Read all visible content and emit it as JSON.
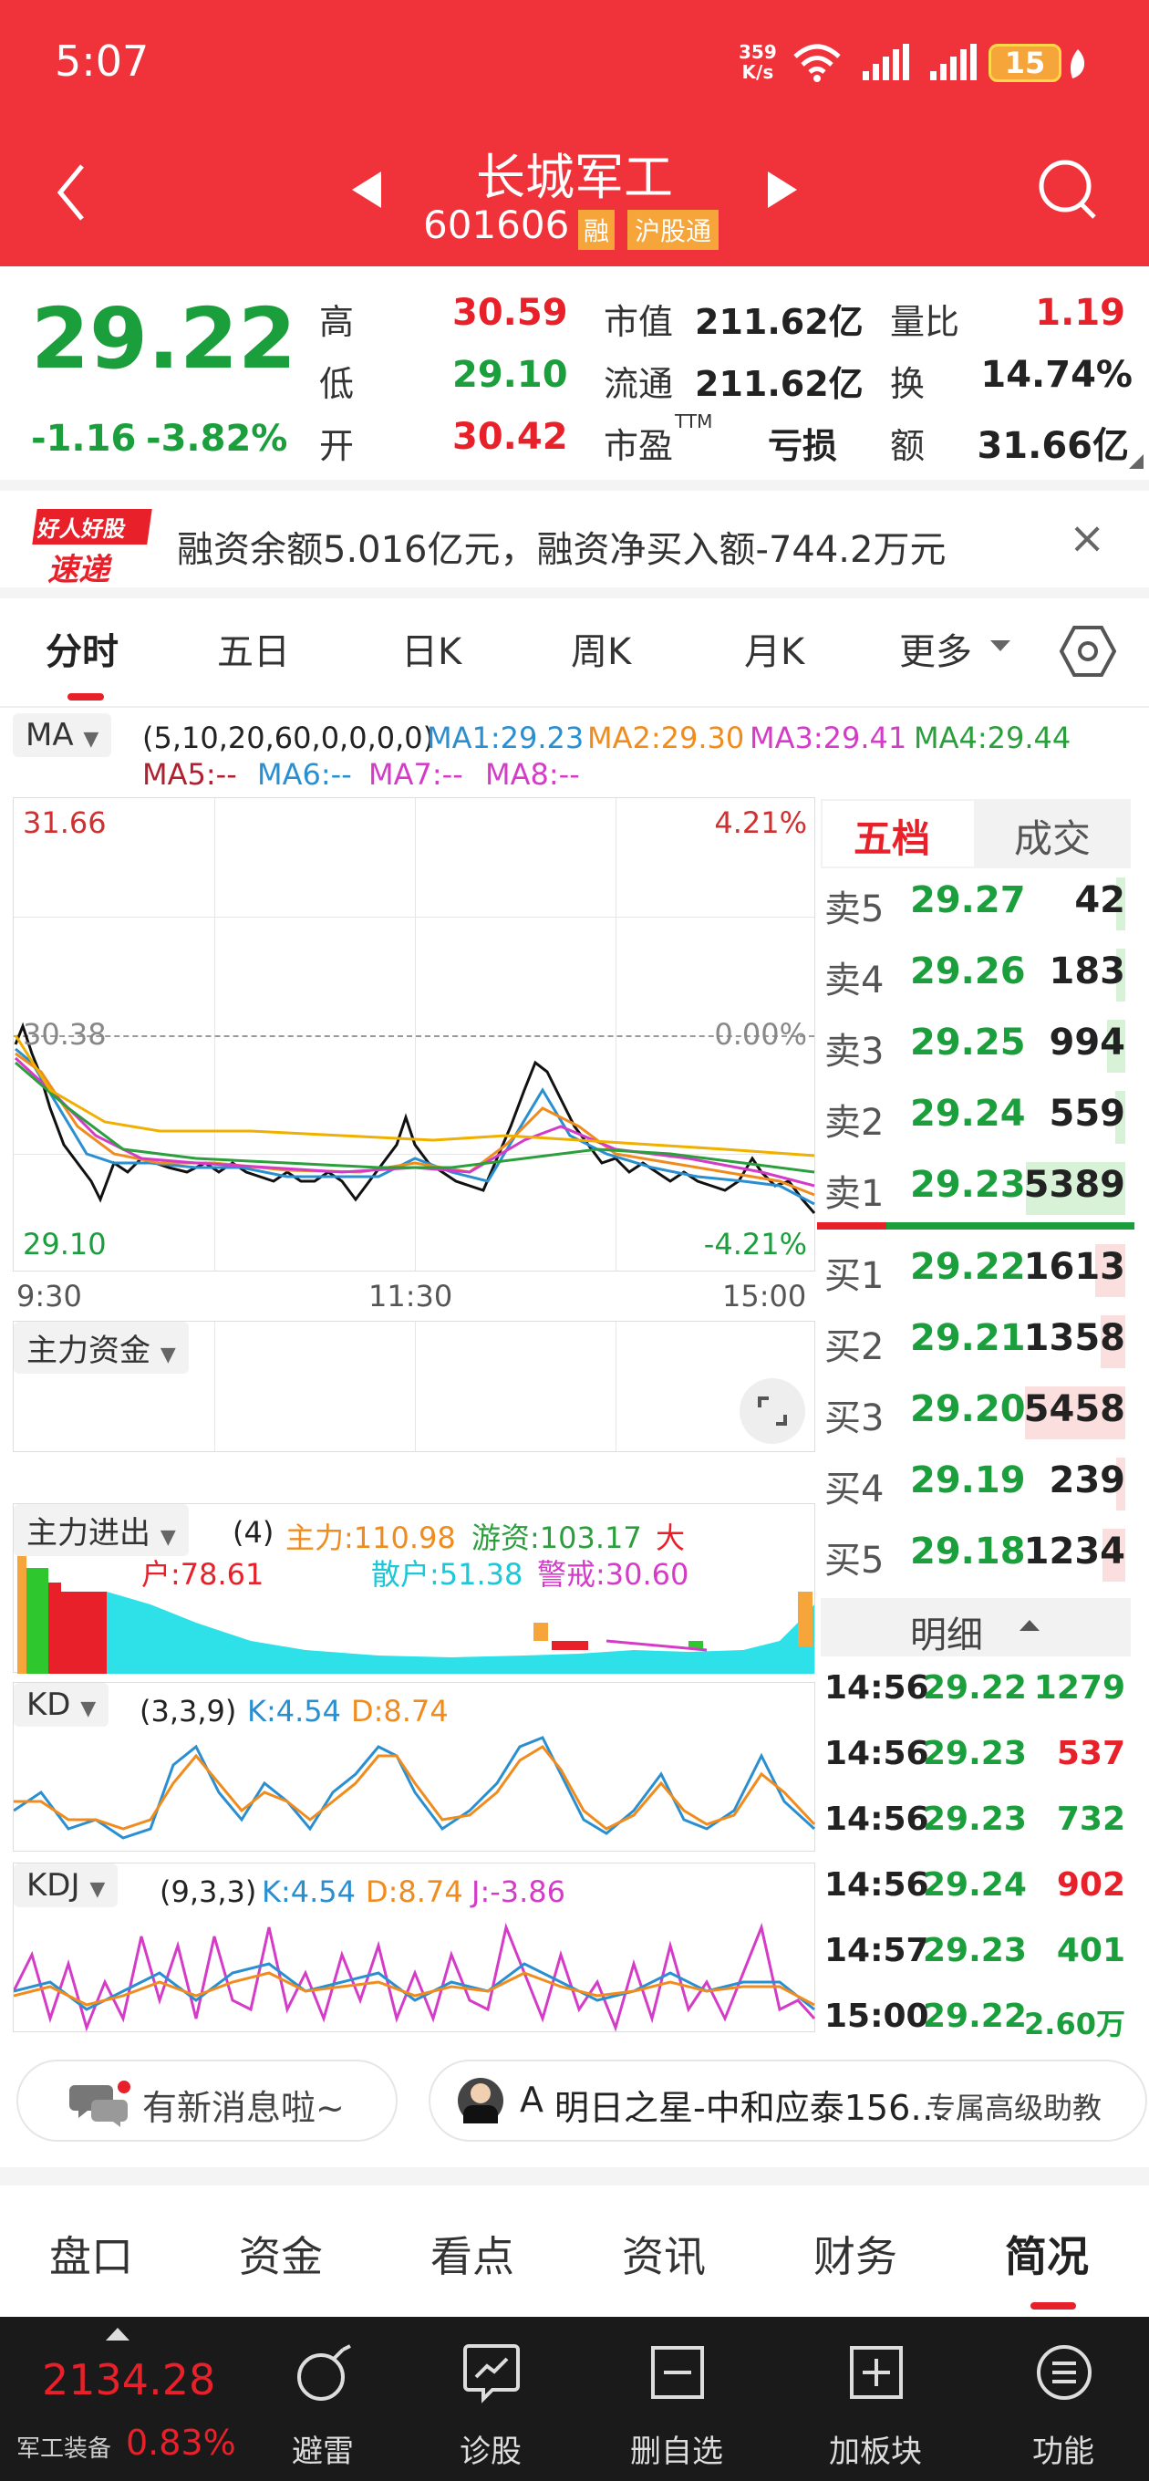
{
  "status_bar": {
    "time": "5:07",
    "net_speed_value": "359",
    "net_speed_unit": "K/s",
    "battery": "15"
  },
  "header": {
    "title": "长城军工",
    "code": "601606",
    "badge_margin": "融",
    "badge_connect": "沪股通"
  },
  "quote": {
    "price": "29.22",
    "change": "-1.16",
    "change_pct": "-3.82%",
    "high_label": "高",
    "high": "30.59",
    "low_label": "低",
    "low": "29.10",
    "open_label": "开",
    "open": "30.42",
    "mcap_label": "市值",
    "mcap": "211.62亿",
    "float_label": "流通",
    "float": "211.62亿",
    "pe_label": "市盈",
    "pe_sup": "TTM",
    "pe": "亏损",
    "vr_label": "量比",
    "vr": "1.19",
    "turn_label": "换",
    "turn": "14.74%",
    "amt_label": "额",
    "amt": "31.66亿"
  },
  "news_banner": {
    "logo_top": "好人好股",
    "logo_bottom": "速递",
    "text": "融资余额5.016亿元，融资净买入额-744.2万元",
    "close": "×"
  },
  "tabs": [
    "分时",
    "五日",
    "日K",
    "周K",
    "月K",
    "更多"
  ],
  "ma": {
    "label": "MA",
    "params": "(5,10,20,60,0,0,0,0)",
    "ma1": "MA1:29.23",
    "ma2": "MA2:29.30",
    "ma3": "MA3:29.41",
    "ma4": "MA4:29.44",
    "ma5": "MA5:--",
    "ma6": "MA6:--",
    "ma7": "MA7:--",
    "ma8": "MA8:--"
  },
  "intraday": {
    "y_top": "31.66",
    "y_top_pct": "4.21%",
    "y_mid": "30.38",
    "y_mid_pct": "0.00%",
    "y_bot": "29.10",
    "y_bot_pct": "-4.21%",
    "x_start": "9:30",
    "x_mid": "11:30",
    "x_end": "15:00"
  },
  "fund_panel": {
    "label": "主力资金"
  },
  "flow_panel": {
    "label": "主力进出",
    "param": "(4)",
    "main": "主力:110.98",
    "hot": "游资:103.17",
    "big_a": "大",
    "big_b": "户:78.61",
    "retail": "散户:51.38",
    "alert": "警戒:30.60"
  },
  "kd": {
    "label": "KD",
    "param": "(3,3,9)",
    "k": "K:4.54",
    "d": "D:8.74"
  },
  "kdj": {
    "label": "KDJ",
    "param": "(9,3,3)",
    "k": "K:4.54",
    "d": "D:8.74",
    "j": "J:-3.86"
  },
  "orderbook": {
    "tab_active": "五档",
    "tab_other": "成交",
    "asks": [
      {
        "label": "卖5",
        "price": "29.27",
        "vol": "42"
      },
      {
        "label": "卖4",
        "price": "29.26",
        "vol": "183"
      },
      {
        "label": "卖3",
        "price": "29.25",
        "vol": "994"
      },
      {
        "label": "卖2",
        "price": "29.24",
        "vol": "559"
      },
      {
        "label": "卖1",
        "price": "29.23",
        "vol": "5389"
      }
    ],
    "bids": [
      {
        "label": "买1",
        "price": "29.22",
        "vol": "1613"
      },
      {
        "label": "买2",
        "price": "29.21",
        "vol": "1358"
      },
      {
        "label": "买3",
        "price": "29.20",
        "vol": "5458"
      },
      {
        "label": "买4",
        "price": "29.19",
        "vol": "239"
      },
      {
        "label": "买5",
        "price": "29.18",
        "vol": "1234"
      }
    ]
  },
  "detail": {
    "title": "明细",
    "rows": [
      {
        "time": "14:56",
        "price": "29.22",
        "vol": "1279",
        "dir": "sell"
      },
      {
        "time": "14:56",
        "price": "29.23",
        "vol": "537",
        "dir": "buy"
      },
      {
        "time": "14:56",
        "price": "29.23",
        "vol": "732",
        "dir": "sell"
      },
      {
        "time": "14:56",
        "price": "29.24",
        "vol": "902",
        "dir": "buy"
      },
      {
        "time": "14:57",
        "price": "29.23",
        "vol": "401",
        "dir": "sell"
      },
      {
        "time": "15:00",
        "price": "29.22",
        "vol": "2.60万",
        "dir": "sell"
      }
    ]
  },
  "chips": {
    "msg": "有新消息啦~",
    "advisor_prefix": "A",
    "advisor": "明日之星-中和应泰156…",
    "advisor_tag": "专属高级助教"
  },
  "bottom_tabs": [
    "盘口",
    "资金",
    "看点",
    "资讯",
    "财务",
    "简况"
  ],
  "footer": {
    "index_value": "2134.28",
    "index_name": "军工装备",
    "index_pct": "0.83%",
    "items": [
      "避雷",
      "诊股",
      "删自选",
      "加板块",
      "功能"
    ]
  },
  "colors": {
    "header_red": "#f0323b",
    "up_red": "#e8202a",
    "down_green": "#1a9f3c",
    "ma1": "#2a8fd0",
    "ma2": "#f08c1e",
    "ma3": "#d43cc8",
    "ma4": "#2a9f3c",
    "avg_line": "#f0b000"
  }
}
